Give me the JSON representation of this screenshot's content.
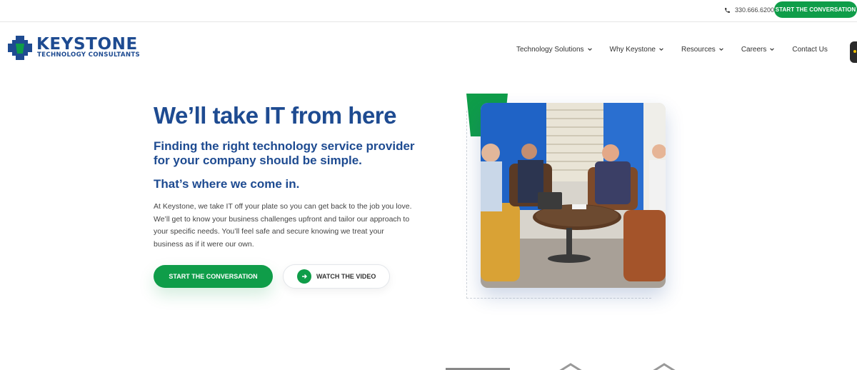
{
  "topbar": {
    "phone": "330.666.6200",
    "phone_icon": "phone-icon",
    "cta_label": "START THE CONVERSATION"
  },
  "logo": {
    "name": "KEYSTONE",
    "sub": "TECHNOLOGY CONSULTANTS"
  },
  "nav": {
    "items": [
      {
        "label": "Technology Solutions",
        "has_dropdown": true
      },
      {
        "label": "Why Keystone",
        "has_dropdown": true
      },
      {
        "label": "Resources",
        "has_dropdown": true
      },
      {
        "label": "Careers",
        "has_dropdown": true
      },
      {
        "label": "Contact Us",
        "has_dropdown": false
      }
    ]
  },
  "hero": {
    "title": "We’ll take IT from here",
    "subtitle": "Finding the right technology service provider for your company should be simple.",
    "subtitle2": "That’s where we come in.",
    "body": "At Keystone, we take IT off your plate so you can get back to the job you love. We’ll get to know your business challenges upfront and tailor our approach to your specific needs. You’ll feel safe and secure knowing we treat your business as if it were our own.",
    "primary_button": "START THE CONVERSATION",
    "video_button": "WATCH THE VIDEO"
  },
  "colors": {
    "brand_blue": "#1e4b91",
    "brand_green": "#0f9d49"
  }
}
